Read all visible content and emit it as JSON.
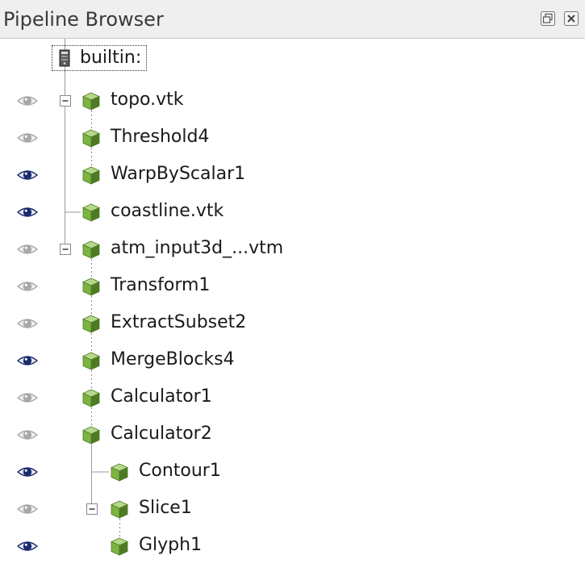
{
  "panel": {
    "title": "Pipeline Browser",
    "buttons": [
      {
        "name": "float-button",
        "icon": "float-icon"
      },
      {
        "name": "close-button",
        "icon": "close-icon"
      }
    ]
  },
  "colors": {
    "eye_visible": "#1a2a6c",
    "eye_hidden": "#a8a8a8",
    "cube_green": "#7cb342",
    "cube_dark": "#4f7a25",
    "cube_light": "#b5d98a"
  },
  "server": {
    "label": "builtin:",
    "icon": "server-icon"
  },
  "items": [
    {
      "label": "topo.vtk",
      "visible": false,
      "depth": 0,
      "expander": "minus"
    },
    {
      "label": "Threshold4",
      "visible": false,
      "depth": 1,
      "expander": null
    },
    {
      "label": "WarpByScalar1",
      "visible": true,
      "depth": 1,
      "expander": null
    },
    {
      "label": "coastline.vtk",
      "visible": true,
      "depth": 0,
      "expander": null
    },
    {
      "label": "atm_input3d_...vtm",
      "visible": false,
      "depth": 0,
      "expander": "minus"
    },
    {
      "label": "Transform1",
      "visible": false,
      "depth": 1,
      "expander": null
    },
    {
      "label": "ExtractSubset2",
      "visible": false,
      "depth": 1,
      "expander": null
    },
    {
      "label": "MergeBlocks4",
      "visible": true,
      "depth": 1,
      "expander": null
    },
    {
      "label": "Calculator1",
      "visible": false,
      "depth": 1,
      "expander": null
    },
    {
      "label": "Calculator2",
      "visible": false,
      "depth": 1,
      "expander": null
    },
    {
      "label": "Contour1",
      "visible": true,
      "depth": 2,
      "expander": null
    },
    {
      "label": "Slice1",
      "visible": false,
      "depth": 2,
      "expander": "minus"
    },
    {
      "label": "Glyph1",
      "visible": true,
      "depth": 3,
      "expander": null
    }
  ]
}
